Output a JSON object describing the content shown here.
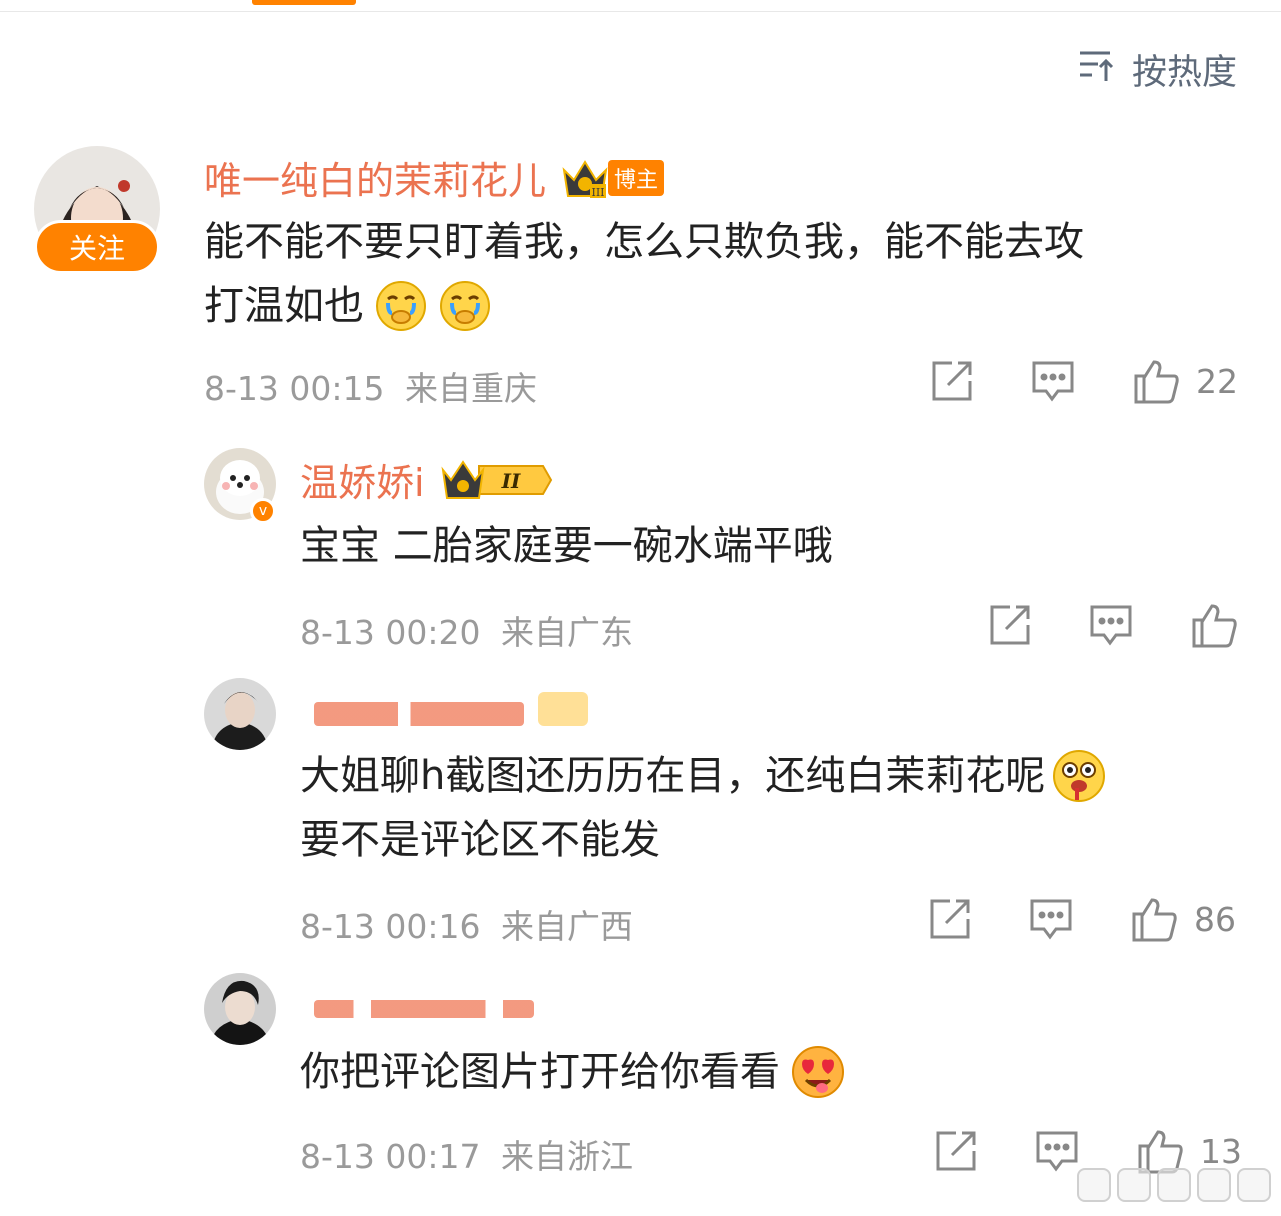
{
  "sort": {
    "label": "按热度",
    "icon": "sort-icon"
  },
  "comments": [
    {
      "username": "唯一纯白的茉莉花儿",
      "badge": "博主",
      "follow_label": "关注",
      "text_line1": "能不能不要只盯着我，怎么只欺负我，能不能去攻",
      "text_line2": "打温如也",
      "emojis": [
        "cry-emoji",
        "cry-emoji"
      ],
      "date": "8-13 00:15",
      "location": "来自重庆",
      "likes": "22"
    },
    {
      "username": "温娇娇i",
      "level": "II",
      "text_line1": "宝宝 二胎家庭要一碗水端平哦",
      "date": "8-13 00:20",
      "location": "来自广东",
      "likes": ""
    },
    {
      "username": "",
      "text_line1": "大姐聊h截图还历历在目，还纯白茉莉花呢",
      "text_line2": "要不是评论区不能发",
      "emojis": [
        "tongue-bleeding-emoji"
      ],
      "date": "8-13 00:16",
      "location": "来自广西",
      "likes": "86"
    },
    {
      "username": "",
      "text_line1": "你把评论图片打开给你看看",
      "emojis": [
        "heart-eyes-emoji"
      ],
      "date": "8-13 00:17",
      "location": "来自浙江",
      "likes": "13"
    }
  ],
  "colors": {
    "accent": "#ff8200",
    "username": "#eb7350",
    "meta": "#9a9a9a"
  }
}
